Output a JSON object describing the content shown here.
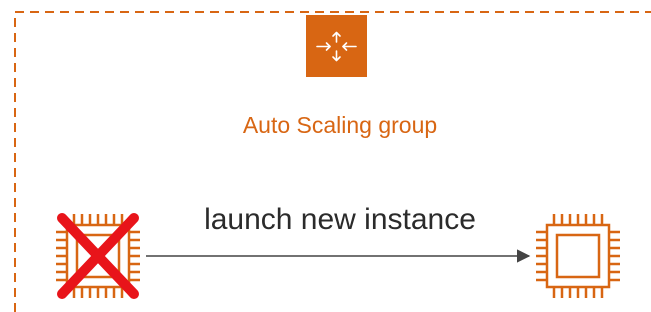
{
  "diagram": {
    "group_label": "Auto Scaling group",
    "action_label": "launch new instance",
    "icons": {
      "group": "auto-scaling-icon",
      "old_instance": "ec2-instance-icon",
      "failed_marker": "red-x-icon",
      "new_instance": "ec2-instance-icon"
    },
    "colors": {
      "aws_orange": "#D86613",
      "failure_red": "#E8141A",
      "arrow": "#444444",
      "label_text": "#2B2B2B"
    }
  }
}
